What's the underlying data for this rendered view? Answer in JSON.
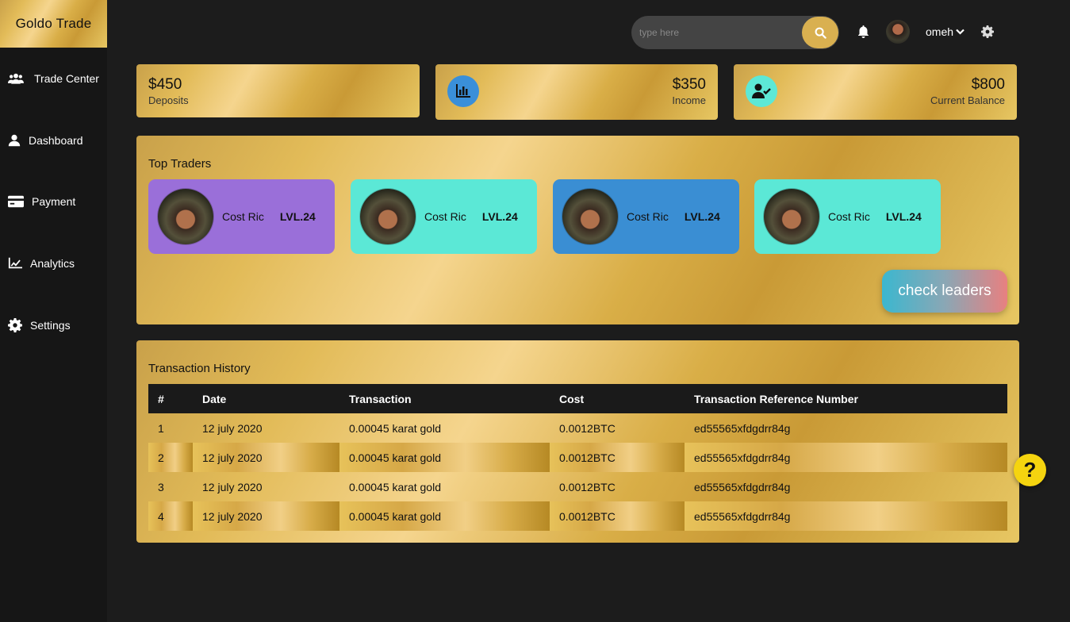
{
  "brand": "Goldo Trade",
  "sidebar": {
    "items": [
      {
        "label": "Trade Center",
        "icon": "users-icon"
      },
      {
        "label": "Dashboard",
        "icon": "user-icon"
      },
      {
        "label": "Payment",
        "icon": "credit-card-icon"
      },
      {
        "label": "Analytics",
        "icon": "chart-line-icon"
      },
      {
        "label": "Settings",
        "icon": "gear-icon"
      }
    ]
  },
  "topbar": {
    "search_placeholder": "type here",
    "username": "omeh"
  },
  "stats": [
    {
      "value": "$450",
      "label": "Deposits"
    },
    {
      "value": "$350",
      "label": "Income",
      "icon": "chart-bar-icon",
      "icon_color": "#3a8fd9"
    },
    {
      "value": "$800",
      "label": "Current Balance",
      "icon": "user-check-icon",
      "icon_color": "#5de8d6"
    }
  ],
  "top_traders": {
    "title": "Top Traders",
    "traders": [
      {
        "name": "Cost Ric",
        "level": "LVL.24",
        "color": "#9a6fd9"
      },
      {
        "name": "Cost Ric",
        "level": "LVL.24",
        "color": "#5be8d6"
      },
      {
        "name": "Cost Ric",
        "level": "LVL.24",
        "color": "#3a8ed3"
      },
      {
        "name": "Cost Ric",
        "level": "LVL.24",
        "color": "#5be8d6"
      }
    ],
    "check_button": "check leaders"
  },
  "transactions": {
    "title": "Transaction History",
    "columns": [
      "#",
      "Date",
      "Transaction",
      "Cost",
      "Transaction Reference Number"
    ],
    "rows": [
      [
        "1",
        "12 july 2020",
        "0.00045 karat gold",
        "0.0012BTC",
        "ed55565xfdgdrr84g"
      ],
      [
        "2",
        "12 july 2020",
        "0.00045 karat gold",
        "0.0012BTC",
        "ed55565xfdgdrr84g"
      ],
      [
        "3",
        "12 july 2020",
        "0.00045 karat gold",
        "0.0012BTC",
        "ed55565xfdgdrr84g"
      ],
      [
        "4",
        "12 july 2020",
        "0.00045 karat gold",
        "0.0012BTC",
        "ed55565xfdgdrr84g"
      ]
    ]
  },
  "help_label": "?",
  "colors": {
    "gold": "#d9b050",
    "sidebar": "#161616",
    "background": "#1c1c1c"
  }
}
